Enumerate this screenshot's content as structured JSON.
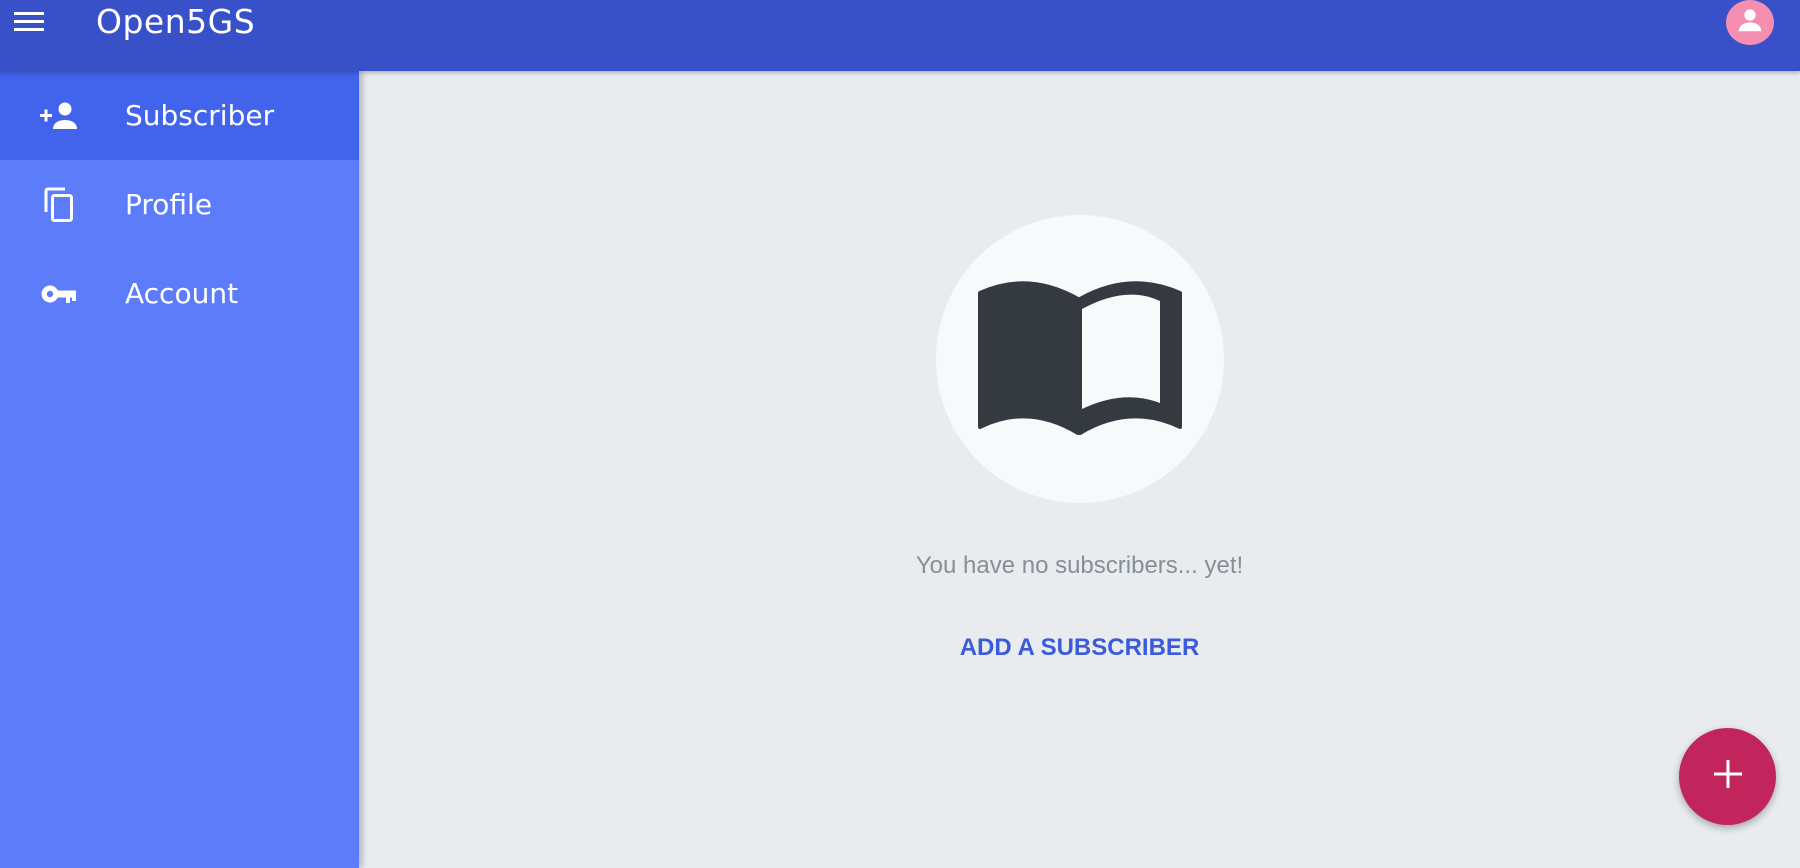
{
  "header": {
    "title": "Open5GS",
    "menu_icon": "hamburger-menu-icon",
    "avatar_icon": "account-icon",
    "background_color": "#3850c8",
    "avatar_color": "#f48fb1"
  },
  "sidebar": {
    "background_color": "#5c7cfa",
    "active_color": "#4263eb",
    "items": [
      {
        "label": "Subscriber",
        "icon": "person-add-icon",
        "active": true
      },
      {
        "label": "Profile",
        "icon": "copy-icon",
        "active": false
      },
      {
        "label": "Account",
        "icon": "key-icon",
        "active": false
      }
    ]
  },
  "main": {
    "empty_state": {
      "icon": "open-book-icon",
      "message": "You have no subscribers... yet!",
      "action_label": "ADD A SUBSCRIBER"
    },
    "fab": {
      "icon": "plus-icon",
      "color": "#c2255c"
    }
  }
}
